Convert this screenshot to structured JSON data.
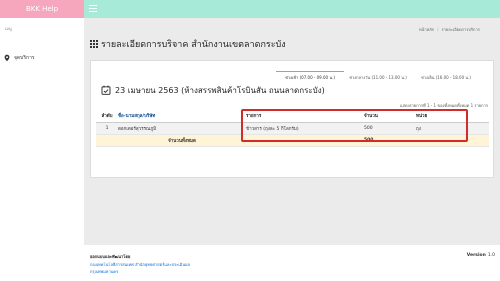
{
  "brand": {
    "name": "BKK Help"
  },
  "sidebar": {
    "heading": "เมนู",
    "items": [
      {
        "label": "จุดบริการ",
        "icon": "map-pin-icon"
      }
    ]
  },
  "breadcrumb": {
    "items": [
      "หน้าหลัก",
      "รายละเอียดการบริการ"
    ]
  },
  "page": {
    "title": "รายละเอียดการบริจาค สำนักงานเขตลาดกระบัง"
  },
  "tabs": [
    {
      "label": "ช่วงเช้า (07.00 - 09.00 น.)",
      "active": true
    },
    {
      "label": "ช่วงกลางวัน (11.00 - 13.00 น.)",
      "active": false
    },
    {
      "label": "ช่วงเย็น (16.00 - 18.00 น.)",
      "active": false
    }
  ],
  "date": {
    "text": "23 เมษายน 2563 (ห้างสรรพสินค้าโรบินสัน ถนนลาดกระบัง)",
    "icon": "calendar-check-icon"
  },
  "table": {
    "summary": "แสดงรายการที่ 1 - 1 ของทั้งหมดทั้งหมด 1 รายการ",
    "headers": [
      "ลำดับ",
      "ชื่อ-นามสกุล/บริษัท",
      "รายการ",
      "จำนวน",
      "หน่วย"
    ],
    "rows": [
      {
        "no": "1",
        "name": "ดอกเตอร์สุวรรณภูมิ",
        "item": "ข้าวสาร (ถุงละ 5 กิโลกรัม)",
        "qty": "500",
        "unit": "ถุง"
      }
    ],
    "total": {
      "label": "จำนวนทั้งหมด",
      "value": "500"
    }
  },
  "footer": {
    "org": "ออกแบบและพัฒนาโดย",
    "links": [
      "กองเทคโนโลยีสารสนเทศ สำนักยุทธศาสตร์และประเมินผล",
      "กรุงเทพมหานคร"
    ],
    "version_label": "Version",
    "version_value": "1.0"
  },
  "colors": {
    "brand_bg": "#f6a6bd",
    "topbar_bg": "#a8ead8",
    "highlight": "#d12b2b",
    "active_tab": "#55b8e8",
    "total_row": "#fff5d6"
  }
}
